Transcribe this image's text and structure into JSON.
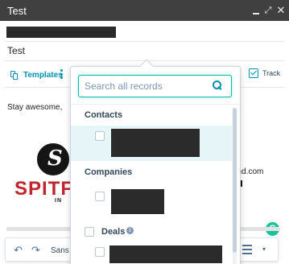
{
  "window": {
    "title": "Test",
    "minimize_icon": "minimize-icon",
    "maximize_glyph": "⤢",
    "close_glyph": "✕"
  },
  "compose": {
    "subject": "Test",
    "body_greeting": "Stay awesome,"
  },
  "toolbar": {
    "templates_label": "Templates",
    "track_label": "Track",
    "track_checked": true,
    "accent_color": "#0091ae"
  },
  "signature": {
    "logo_letter": "S",
    "logo_word": "SPITFI",
    "logo_sub": "IN",
    "email_fragment": "und.com",
    "brand_color": "#c0262d"
  },
  "record_picker": {
    "search_placeholder": "Search all records",
    "search_value": "",
    "sections": [
      {
        "label": "Contacts"
      },
      {
        "label": "Companies"
      },
      {
        "label": "Deals",
        "has_info": true
      }
    ]
  },
  "editor": {
    "undo_glyph": "↶",
    "redo_glyph": "↷",
    "font_label": "Sans S",
    "chevron_glyph": "▾"
  },
  "grammarly": {
    "glyph": "G",
    "color": "#15c39a"
  }
}
